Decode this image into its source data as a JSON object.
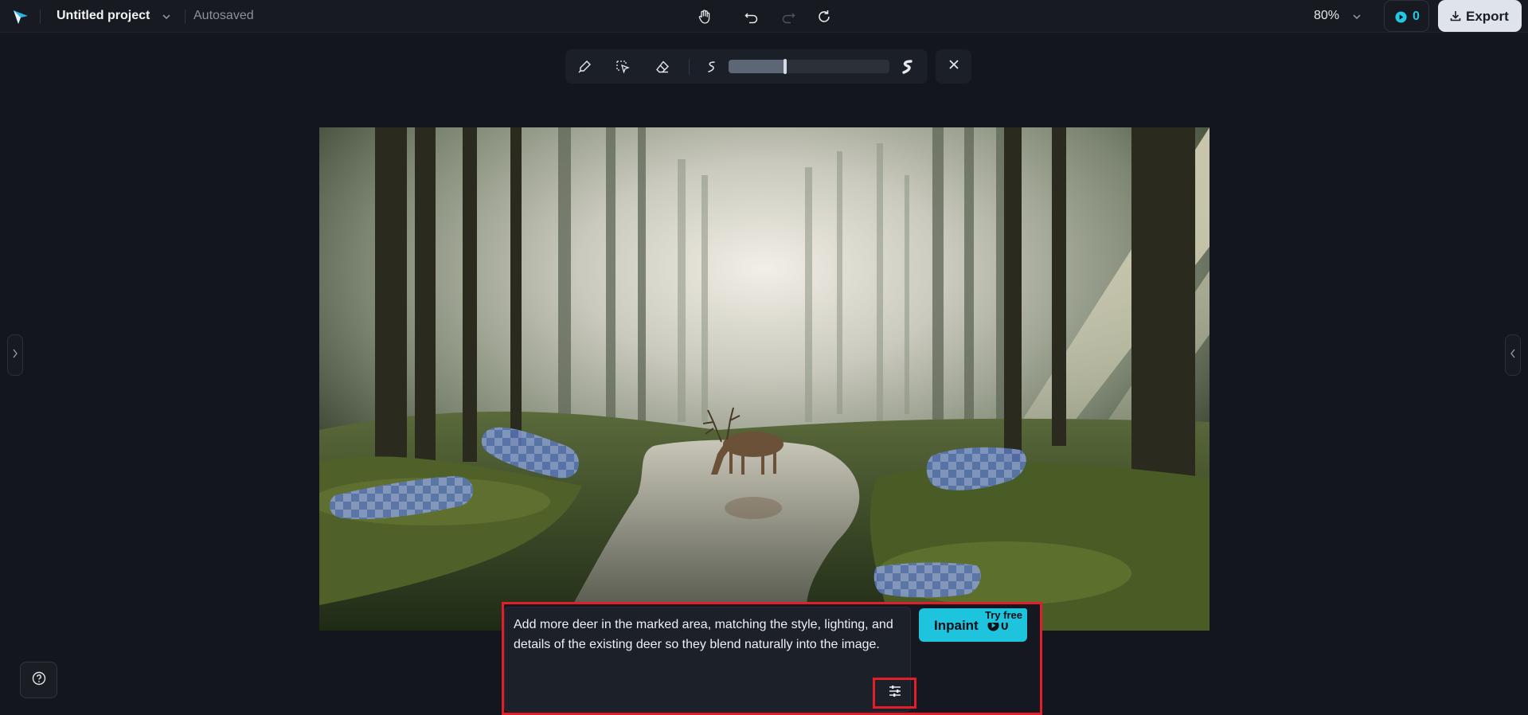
{
  "header": {
    "project_title": "Untitled project",
    "save_status": "Autosaved",
    "zoom": "80%",
    "credits": "0",
    "export_label": "Export",
    "icons": [
      "app-logo-icon",
      "chevron-down-icon",
      "hand-pan-icon",
      "undo-icon",
      "redo-icon",
      "refresh-icon",
      "coin-icon",
      "download-icon"
    ]
  },
  "toolbar": {
    "tools": [
      "brush-icon",
      "lasso-select-icon",
      "eraser-icon"
    ],
    "brush_size_min_icon": "small-brush-icon",
    "brush_size_max_icon": "large-brush-icon",
    "brush_size_level": 0.35,
    "close_icon": "close-icon"
  },
  "canvas": {
    "description_icon": "image-canvas"
  },
  "prompt": {
    "text": "Add more deer in the marked area, matching the style, lighting, and details of the existing deer so they blend naturally into the image.",
    "settings_icon": "sliders-icon",
    "inpaint_label": "Inpaint",
    "inpaint_cost": "0",
    "badge": "Try free"
  },
  "colors": {
    "accent": "#1ec3de",
    "highlight": "#e21e2a",
    "mask": "#5a78c0"
  }
}
